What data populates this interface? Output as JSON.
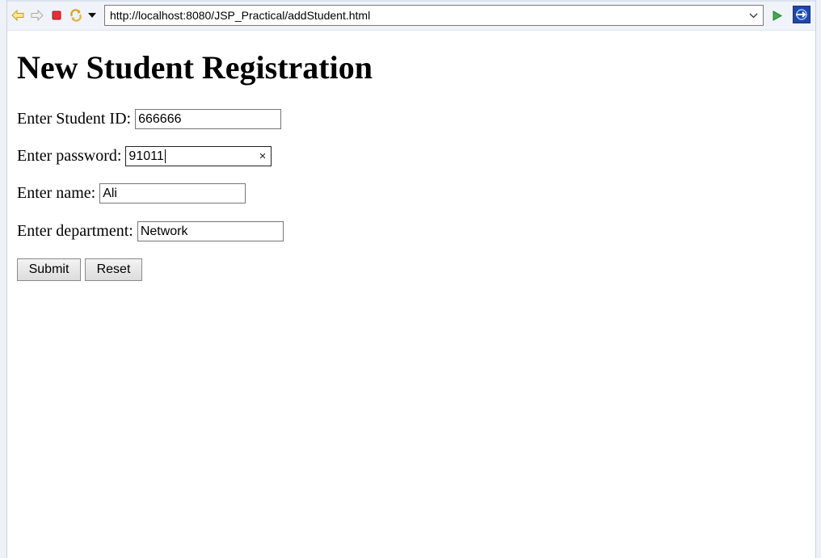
{
  "browser": {
    "url": "http://localhost:8080/JSP_Practical/addStudent.html",
    "icons": [
      "back-arrow-icon",
      "forward-arrow-icon",
      "stop-icon",
      "refresh-icon",
      "menu-dropdown-icon",
      "url-dropdown-icon",
      "go-icon",
      "external-browser-icon"
    ]
  },
  "page": {
    "title": "New Student Registration",
    "fields": [
      {
        "label": "Enter Student ID:",
        "value": "666666"
      },
      {
        "label": "Enter password:",
        "value": "91011",
        "clear_glyph": "×"
      },
      {
        "label": "Enter name:",
        "value": "Ali"
      },
      {
        "label": "Enter department:",
        "value": "Network"
      }
    ],
    "buttons": {
      "submit": "Submit",
      "reset": "Reset"
    }
  }
}
